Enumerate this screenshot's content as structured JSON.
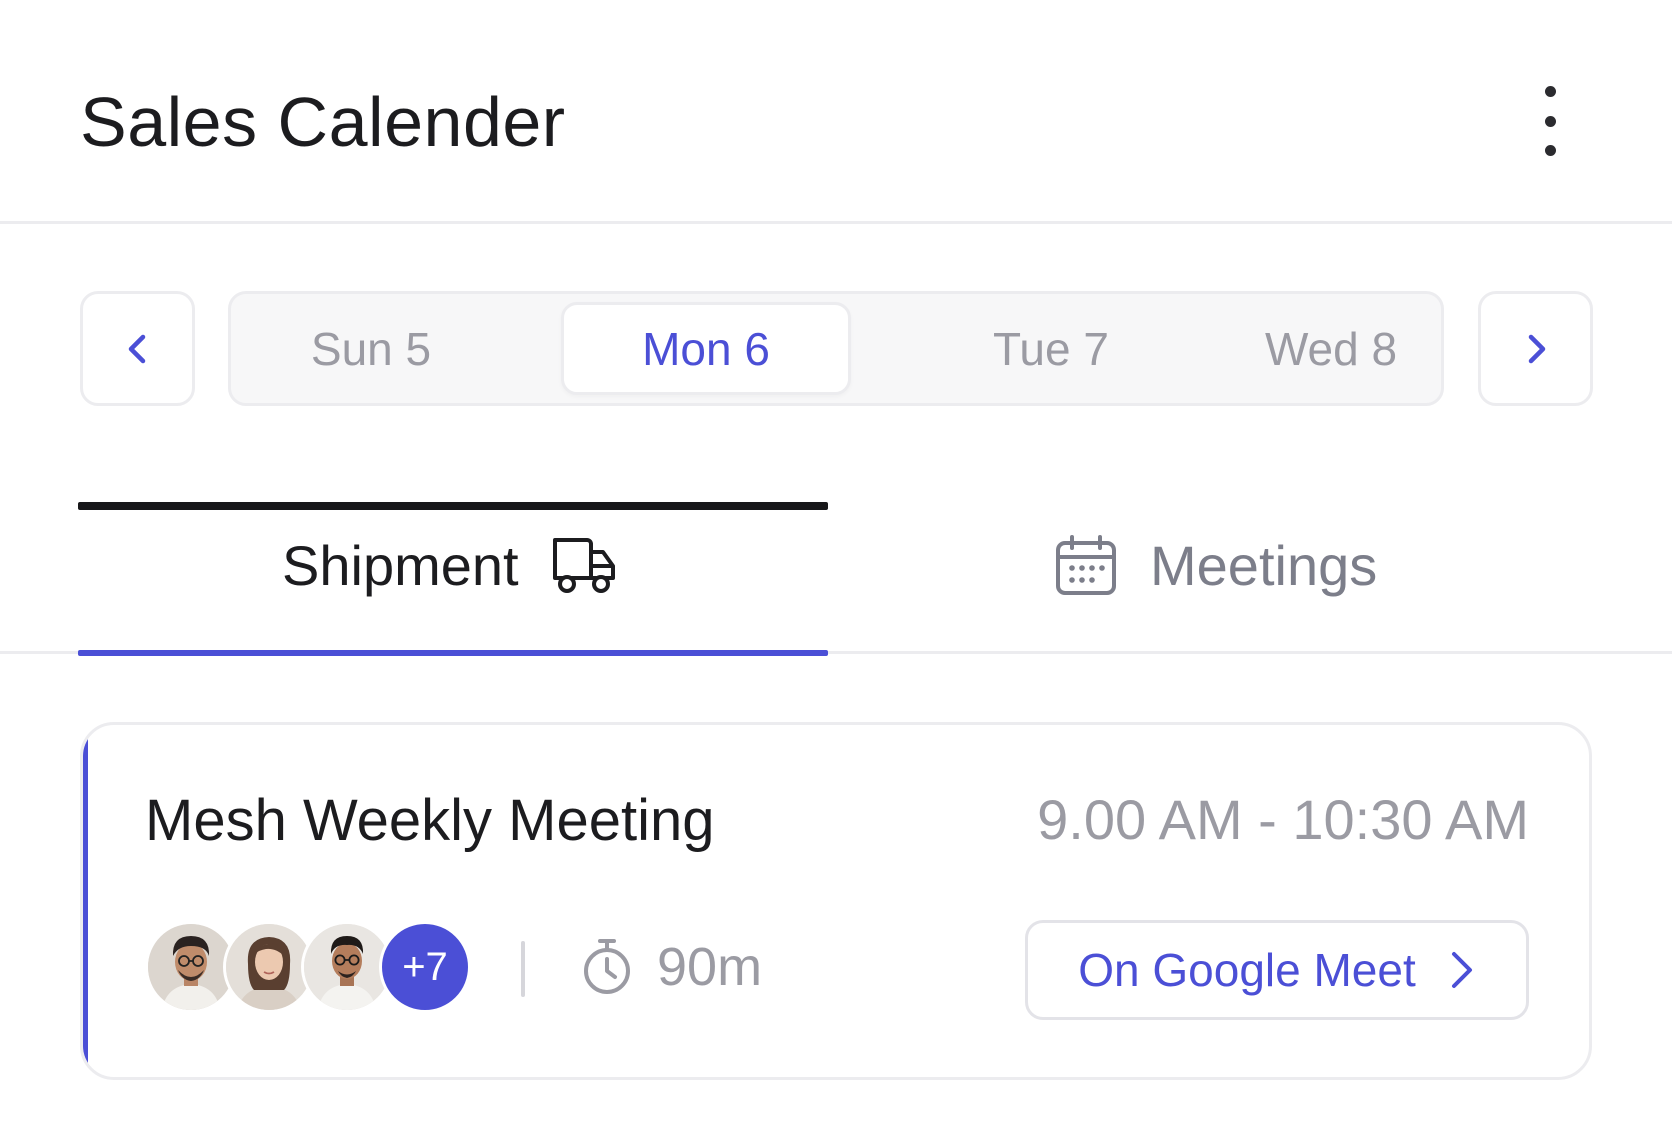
{
  "header": {
    "title": "Sales Calender"
  },
  "date_strip": {
    "days": [
      {
        "label": "Sun 5",
        "selected": false
      },
      {
        "label": "Mon 6",
        "selected": true
      },
      {
        "label": "Tue 7",
        "selected": false
      },
      {
        "label": "Wed 8",
        "selected": false
      }
    ]
  },
  "tabs": [
    {
      "label": "Shipment",
      "icon": "truck-icon",
      "active": true
    },
    {
      "label": "Meetings",
      "icon": "calendar-icon",
      "active": false
    }
  ],
  "meeting": {
    "title": "Mesh Weekly Meeting",
    "time": "9.00 AM - 10:30 AM",
    "extra_attendees": "+7",
    "duration": "90m",
    "location_button": "On Google Meet"
  },
  "colors": {
    "accent": "#4b4fd6",
    "text_primary": "#1c1c1f",
    "text_muted": "#9b9ba3",
    "border": "#ececef"
  }
}
